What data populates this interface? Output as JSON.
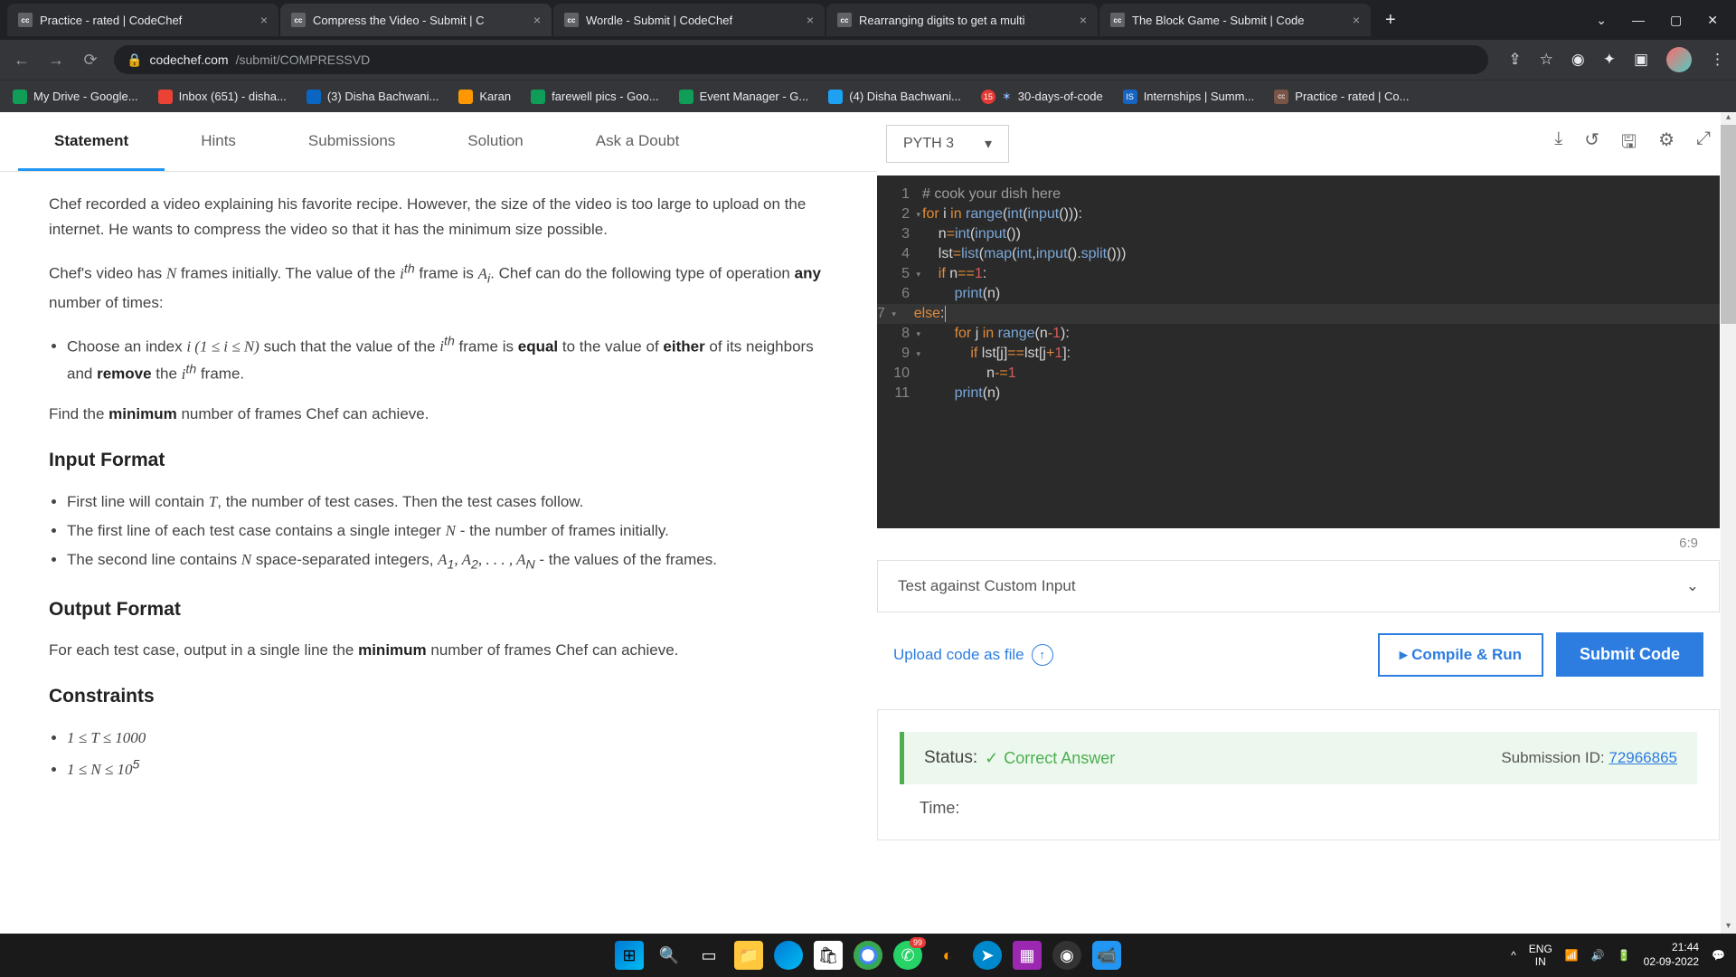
{
  "browser": {
    "tabs": [
      {
        "title": "Practice - rated | CodeChef"
      },
      {
        "title": "Compress the Video - Submit | C",
        "active": true
      },
      {
        "title": "Wordle - Submit | CodeChef"
      },
      {
        "title": "Rearranging digits to get a multi"
      },
      {
        "title": "The Block Game - Submit | Code"
      }
    ],
    "url_host": "codechef.com",
    "url_path": "/submit/COMPRESSVD",
    "bookmarks": [
      {
        "label": "My Drive - Google...",
        "color": "#0f9d58"
      },
      {
        "label": "Inbox (651) - disha...",
        "color": "#ea4335"
      },
      {
        "label": "(3) Disha Bachwani...",
        "color": "#0a66c2"
      },
      {
        "label": "Karan",
        "color": "#ff9800"
      },
      {
        "label": "farewell pics - Goo...",
        "color": "#0f9d58"
      },
      {
        "label": "Event Manager - G...",
        "color": "#0f9d58"
      },
      {
        "label": "(4) Disha Bachwani...",
        "color": "#1da1f2"
      },
      {
        "label": "30-days-of-code",
        "color": "#e53935"
      },
      {
        "label": "Internships | Summ...",
        "color": "#1565c0"
      },
      {
        "label": "Practice - rated | Co...",
        "color": "#795548"
      }
    ]
  },
  "page_tabs": {
    "statement": "Statement",
    "hints": "Hints",
    "submissions": "Submissions",
    "solution": "Solution",
    "doubt": "Ask a Doubt"
  },
  "problem": {
    "p1": "Chef recorded a video explaining his favorite recipe. However, the size of the video is too large to upload on the internet. He wants to compress the video so that it has the minimum size possible.",
    "p2a": "Chef's video has ",
    "p2b": " frames initially. The value of the ",
    "p2c": " frame is ",
    "p2d": ". Chef can do the following type of operation ",
    "p2e": " number of times:",
    "li1a": "Choose an index ",
    "li1b": " such that the value of the ",
    "li1c": " frame is ",
    "li1d": " to the value of ",
    "li1e": " of its neighbors and ",
    "li1f": " the ",
    "li1g": " frame.",
    "p3a": "Find the ",
    "p3b": " number of frames Chef can achieve.",
    "h_input": "Input Format",
    "in1a": "First line will contain ",
    "in1b": ", the number of test cases. Then the test cases follow.",
    "in2a": "The first line of each test case contains a single integer ",
    "in2b": " - the number of frames initially.",
    "in3a": "The second line contains ",
    "in3b": " space-separated integers, ",
    "in3c": " - the values of the frames.",
    "h_output": "Output Format",
    "out1a": "For each test case, output in a single line the ",
    "out1b": " number of frames Chef can achieve.",
    "h_constraints": "Constraints",
    "word_any": "any",
    "word_equal": "equal",
    "word_either": "either",
    "word_remove": "remove",
    "word_minimum": "minimum"
  },
  "editor": {
    "language": "PYTH 3",
    "cursor": "6:9",
    "custom_input": "Test against Custom Input",
    "upload": "Upload code as file",
    "compile": "Compile & Run",
    "submit": "Submit Code"
  },
  "status": {
    "label": "Status:",
    "value": "Correct Answer",
    "sub_label": "Submission ID: ",
    "sub_id": "72966865",
    "time_label": "Time:"
  },
  "taskbar": {
    "lang1": "ENG",
    "lang2": "IN",
    "time": "21:44",
    "date": "02-09-2022",
    "badge": "99"
  }
}
